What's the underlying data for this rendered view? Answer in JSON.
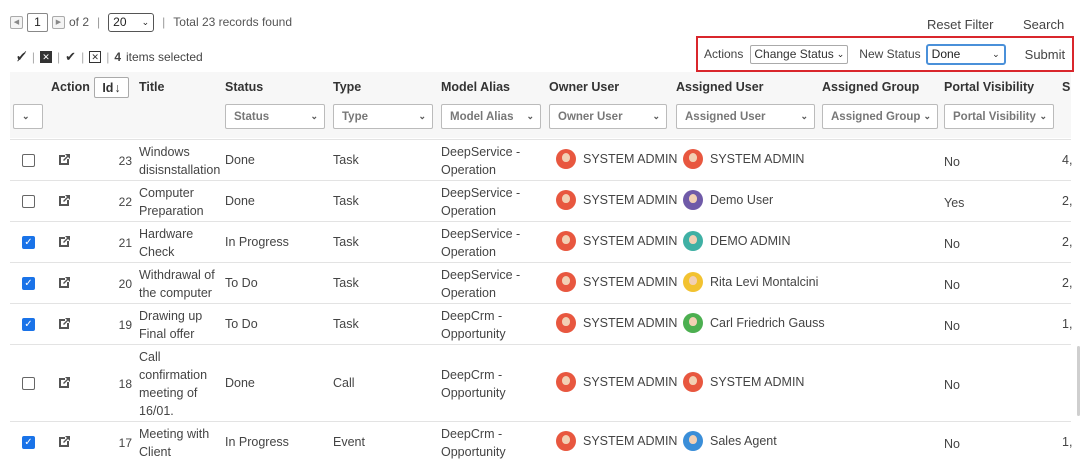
{
  "pager": {
    "page": "1",
    "of_label": "of 2",
    "page_size": "20",
    "total": "Total 23 records found"
  },
  "links": {
    "reset_filter": "Reset Filter",
    "search": "Search"
  },
  "selection": {
    "count": "4",
    "suffix": "items selected"
  },
  "actions": {
    "label": "Actions",
    "action_value": "Change Status",
    "new_status_label": "New Status",
    "new_status_value": "Done",
    "submit": "Submit"
  },
  "columns": {
    "action": "Action",
    "id": "Id",
    "title": "Title",
    "status": "Status",
    "type": "Type",
    "model_alias": "Model Alias",
    "owner_user": "Owner User",
    "assigned_user": "Assigned User",
    "assigned_group": "Assigned Group",
    "portal_visibility": "Portal Visibility",
    "extra": "S"
  },
  "filters": {
    "status": "Status",
    "type": "Type",
    "model_alias": "Model Alias",
    "owner_user": "Owner User",
    "assigned_user": "Assigned User",
    "assigned_group": "Assigned Group",
    "portal_visibility": "Portal Visibility"
  },
  "rows": [
    {
      "checked": false,
      "id": "23",
      "title": [
        "Windows",
        "disisnstallation"
      ],
      "status": "Done",
      "type": "Task",
      "model": [
        "DeepService -",
        "Operation"
      ],
      "owner": "SYSTEM ADMIN",
      "assigned": "SYSTEM ADMIN",
      "assigned_avatar": "admin",
      "portal": "No",
      "extra": "4,"
    },
    {
      "checked": false,
      "id": "22",
      "title": [
        "Computer",
        "Preparation"
      ],
      "status": "Done",
      "type": "Task",
      "model": [
        "DeepService -",
        "Operation"
      ],
      "owner": "SYSTEM ADMIN",
      "assigned": "Demo User",
      "assigned_avatar": "purple",
      "portal": "Yes",
      "extra": "2,"
    },
    {
      "checked": true,
      "id": "21",
      "title": [
        "Hardware",
        "Check"
      ],
      "status": "In Progress",
      "type": "Task",
      "model": [
        "DeepService -",
        "Operation"
      ],
      "owner": "SYSTEM ADMIN",
      "assigned": "DEMO ADMIN",
      "assigned_avatar": "teal",
      "portal": "No",
      "extra": "2,"
    },
    {
      "checked": true,
      "id": "20",
      "title": [
        "Withdrawal of",
        "the computer"
      ],
      "status": "To Do",
      "type": "Task",
      "model": [
        "DeepService -",
        "Operation"
      ],
      "owner": "SYSTEM ADMIN",
      "assigned": "Rita Levi Montalcini",
      "assigned_avatar": "yellow",
      "portal": "No",
      "extra": "2,"
    },
    {
      "checked": true,
      "id": "19",
      "title": [
        "Drawing up",
        "Final offer"
      ],
      "status": "To Do",
      "type": "Task",
      "model": [
        "DeepCrm -",
        "Opportunity"
      ],
      "owner": "SYSTEM ADMIN",
      "assigned": "Carl Friedrich Gauss",
      "assigned_avatar": "green",
      "portal": "No",
      "extra": "1,"
    },
    {
      "checked": false,
      "id": "18",
      "title": [
        "Call",
        "confirmation",
        "meeting of",
        "16/01."
      ],
      "status": "Done",
      "type": "Call",
      "model": [
        "DeepCrm -",
        "Opportunity"
      ],
      "owner": "SYSTEM ADMIN",
      "assigned": "SYSTEM ADMIN",
      "assigned_avatar": "admin",
      "portal": "No",
      "extra": ""
    },
    {
      "checked": true,
      "id": "17",
      "title": [
        "Meeting with",
        "Client"
      ],
      "status": "In Progress",
      "type": "Event",
      "model": [
        "DeepCrm -",
        "Opportunity"
      ],
      "owner": "SYSTEM ADMIN",
      "assigned": "Sales Agent",
      "assigned_avatar": "blue",
      "portal": "No",
      "extra": "1,"
    }
  ],
  "avatar_colors": {
    "admin": "#e8573f",
    "purple": "#6f5aa8",
    "teal": "#3fb0a4",
    "yellow": "#f2c230",
    "green": "#4caf50",
    "blue": "#3a8ed8"
  },
  "colors": {
    "highlight_border": "#d9262c",
    "checkbox_blue": "#1a73e8",
    "focus_blue": "#4a90d9"
  }
}
